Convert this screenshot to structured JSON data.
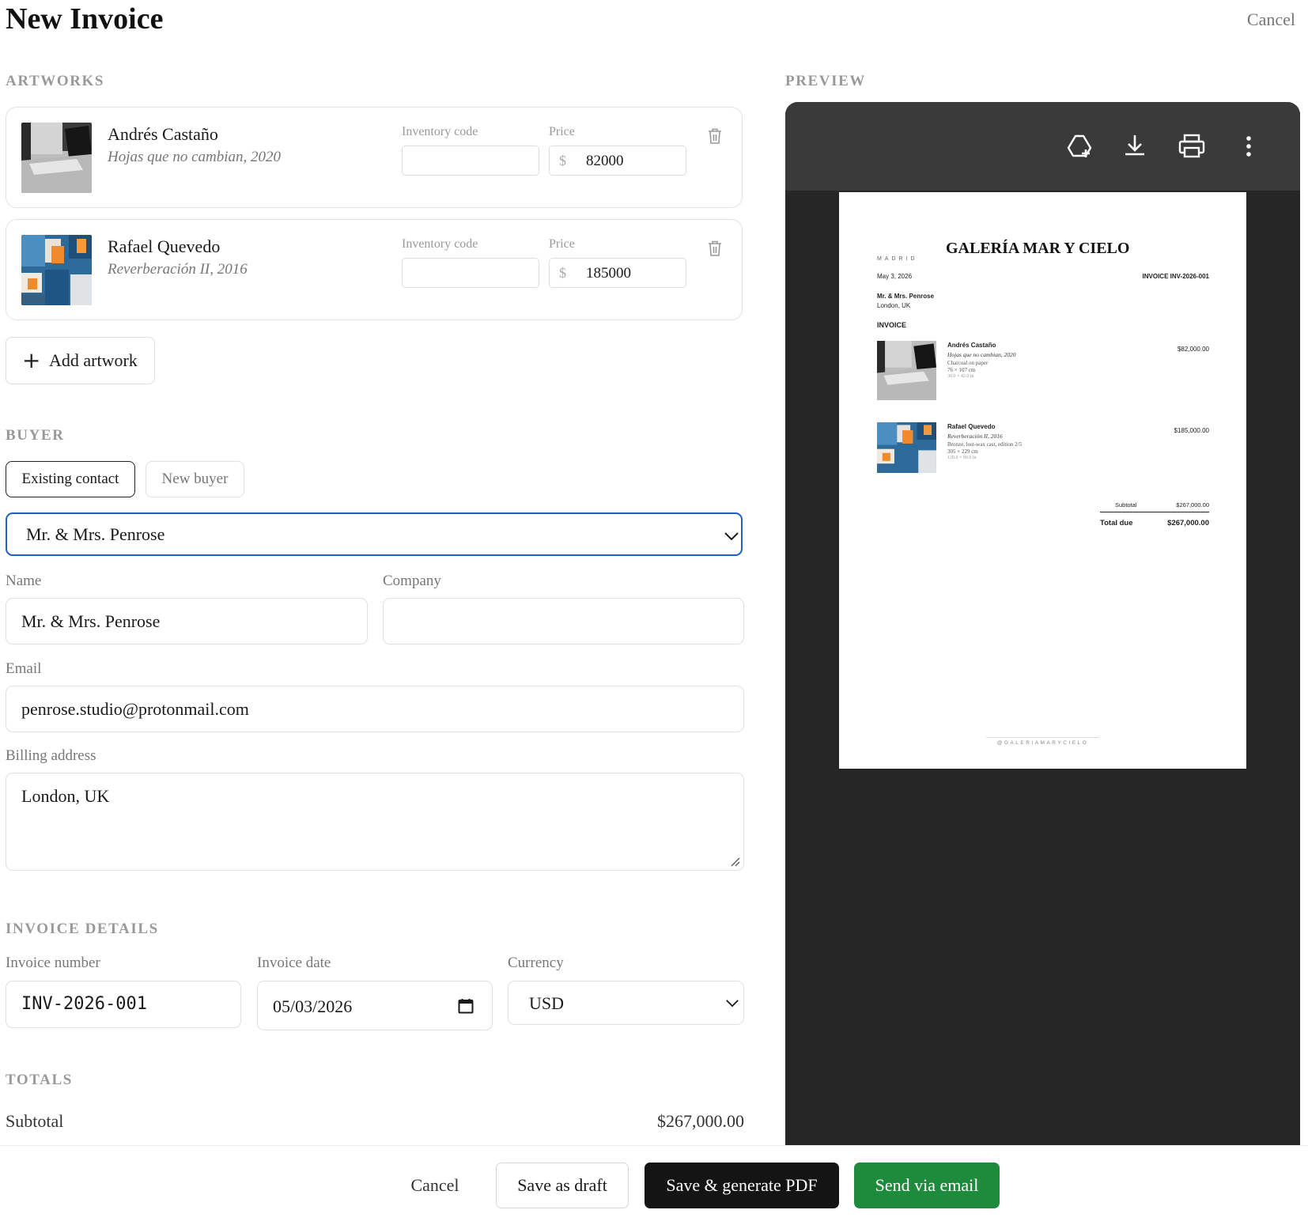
{
  "header": {
    "title": "New Invoice",
    "cancel_label": "Cancel"
  },
  "artworks": {
    "section_label": "ARTWORKS",
    "inventory_label": "Inventory code",
    "price_label": "Price",
    "currency_symbol": "$",
    "items": [
      {
        "artist": "Andrés Castaño",
        "title": "Hojas que no cambian, 2020",
        "inventory_code": "",
        "price": "82000"
      },
      {
        "artist": "Rafael Quevedo",
        "title": "Reverberación II, 2016",
        "inventory_code": "",
        "price": "185000"
      }
    ],
    "add_label": "Add artwork"
  },
  "buyer": {
    "section_label": "BUYER",
    "tabs": [
      "Existing contact",
      "New buyer"
    ],
    "selected_contact": "Mr. & Mrs. Penrose",
    "name_label": "Name",
    "name_value": "Mr. & Mrs. Penrose",
    "company_label": "Company",
    "company_value": "",
    "email_label": "Email",
    "email_value": "penrose.studio@protonmail.com",
    "address_label": "Billing address",
    "address_value": "London, UK"
  },
  "invoice_details": {
    "section_label": "INVOICE DETAILS",
    "number_label": "Invoice number",
    "number_value": "INV-2026-001",
    "date_label": "Invoice date",
    "date_value": "05/03/2026",
    "currency_label": "Currency",
    "currency_value": "USD"
  },
  "totals": {
    "section_label": "TOTALS",
    "subtotal_label": "Subtotal",
    "subtotal_value": "$267,000.00"
  },
  "footer": {
    "cancel": "Cancel",
    "save_draft": "Save as draft",
    "save_pdf": "Save & generate PDF",
    "send_email": "Send via email"
  },
  "preview": {
    "section_label": "PREVIEW",
    "toolbar_icons": [
      "add-to-drive-icon",
      "download-icon",
      "print-icon",
      "more-vert-icon"
    ],
    "doc": {
      "city": "MADRID",
      "gallery_name": "GALERÍA MAR Y CIELO",
      "date": "May 3, 2026",
      "invoice_no": "INVOICE INV-2026-001",
      "buyer_name": "Mr. & Mrs. Penrose",
      "buyer_address": "London, UK",
      "heading": "INVOICE",
      "items": [
        {
          "artist": "Andrés Castaño",
          "title": "Hojas que no cambian, 2020",
          "medium": "Charcoal on paper",
          "dims_cm": "76 × 107 cm",
          "dims_in": "30.0 × 42.0 in",
          "price": "$82,000.00"
        },
        {
          "artist": "Rafael Quevedo",
          "title": "Reverberación II, 2016",
          "medium": "Bronze, lost-wax cast, edition 2/5",
          "dims_cm": "305 × 229 cm",
          "dims_in": "120.0 × 90.0 in",
          "price": "$185,000.00"
        }
      ],
      "subtotal_label": "Subtotal",
      "subtotal": "$267,000.00",
      "total_label": "Total due",
      "total": "$267,000.00",
      "footer_handle": "@GALERIAMARYCIELO"
    }
  },
  "colors": {
    "focus_blue": "#1f5fc6",
    "primary_black": "#1a1a1a",
    "send_green": "#1e8a3c",
    "preview_bg": "#262626"
  }
}
